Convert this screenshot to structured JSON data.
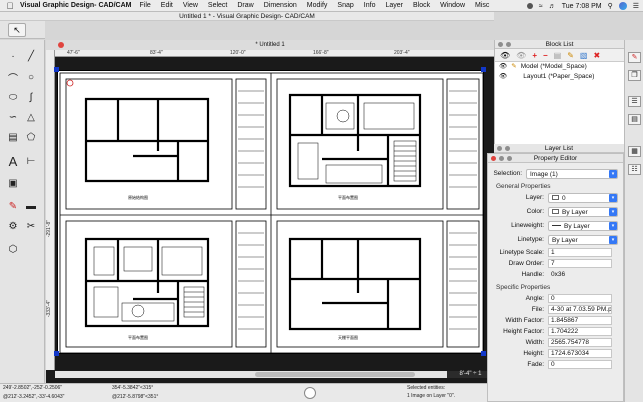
{
  "menubar": {
    "app_name": "Visual Graphic Design- CAD/CAM",
    "items": [
      "File",
      "Edit",
      "View",
      "Select",
      "Draw",
      "Dimension",
      "Modify",
      "Snap",
      "Info",
      "Layer",
      "Block",
      "Window",
      "Misc"
    ],
    "clock": "Tue 7:08 PM"
  },
  "window": {
    "title": "Untitled 1 * - Visual Graphic Design- CAD/CAM"
  },
  "document_tab": {
    "label": "* Untitled 1"
  },
  "ruler": {
    "top_labels": [
      "47'-6\"",
      "83'-4\"",
      "120'-0\"",
      "166'-8\"",
      "203'-4\""
    ],
    "left_labels": [
      "-291'-8\"",
      "-333'-4\""
    ]
  },
  "sheet_labels": [
    "原始结构图",
    "平面布置图",
    "平面布置图",
    "天棚平面图"
  ],
  "statusbar": {
    "coords": [
      "249'-2.8502\",-252'-0.2506\"",
      "354'-5.3842\"<315°",
      "@212'-3.2452\",-33'-4.6043\"",
      "@212'-5.8798\"<351°"
    ],
    "selection_line1": "Selected entities:",
    "selection_line2": "1 Image on Layer \"0\"."
  },
  "coord_readout": "8'-4\" ÷ 1",
  "block_list": {
    "title": "Block List",
    "toolbar_icons": [
      "eye-icon",
      "eye-off-icon",
      "add-icon",
      "remove-icon",
      "insert-icon",
      "edit-icon",
      "attributes-icon",
      "delete-icon"
    ],
    "items": [
      {
        "label": "Model (*Model_Space)"
      },
      {
        "label": "Layout1 (*Paper_Space)"
      }
    ]
  },
  "layer_list": {
    "title": "Layer List"
  },
  "property_editor": {
    "title": "Property Editor",
    "selection_label": "Selection:",
    "selection_value": "Image (1)",
    "general_header": "General Properties",
    "general": [
      {
        "label": "Layer:",
        "value": "0",
        "kind": "dropdown"
      },
      {
        "label": "Color:",
        "value": "By Layer",
        "kind": "dropdown"
      },
      {
        "label": "Lineweight:",
        "value": "By Layer",
        "kind": "dropdown"
      },
      {
        "label": "Linetype:",
        "value": "By Layer",
        "kind": "dropdown"
      },
      {
        "label": "Linetype Scale:",
        "value": "1",
        "kind": "text"
      },
      {
        "label": "Draw Order:",
        "value": "7",
        "kind": "text"
      },
      {
        "label": "Handle:",
        "value": "0x36",
        "kind": "readonly"
      }
    ],
    "specific_header": "Specific Properties",
    "specific": [
      {
        "label": "Angle:",
        "value": "0"
      },
      {
        "label": "File:",
        "value": "4-30 at 7.03.59 PM.png"
      },
      {
        "label": "Width Factor:",
        "value": "1.845867"
      },
      {
        "label": "Height Factor:",
        "value": "1.704222"
      },
      {
        "label": "Width:",
        "value": "2565.754778"
      },
      {
        "label": "Height:",
        "value": "1724.673034"
      },
      {
        "label": "Fade:",
        "value": "0"
      }
    ]
  },
  "colors": {
    "accent": "#3478f6",
    "selection_handle": "#1238c9",
    "canvas_bg": "#1a1a1a",
    "close_red": "#e0443e"
  }
}
